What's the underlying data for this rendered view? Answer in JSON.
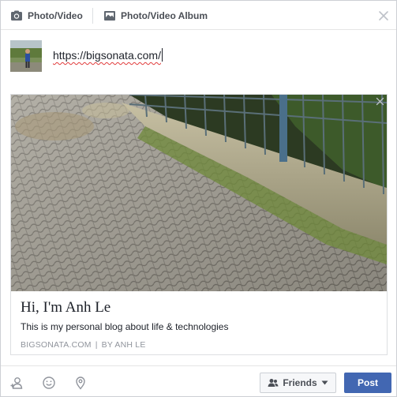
{
  "tabs": [
    {
      "label": "Photo/Video",
      "icon": "camera-icon"
    },
    {
      "label": "Photo/Video Album",
      "icon": "photo-album-icon"
    }
  ],
  "status": {
    "text": "https://bigsonata.com/"
  },
  "link_preview": {
    "title": "Hi, I'm Anh Le",
    "description": "This is my personal blog about life & technologies",
    "domain": "BIGSONATA.COM",
    "separator": "|",
    "byline": "BY ANH LE"
  },
  "actions": {
    "icons": [
      "tag-people-icon",
      "feeling-icon",
      "location-icon"
    ],
    "audience_label": "Friends",
    "post_label": "Post"
  },
  "colors": {
    "accent": "#4267b2",
    "border": "#dddfe2",
    "muted_text": "#90949c"
  }
}
